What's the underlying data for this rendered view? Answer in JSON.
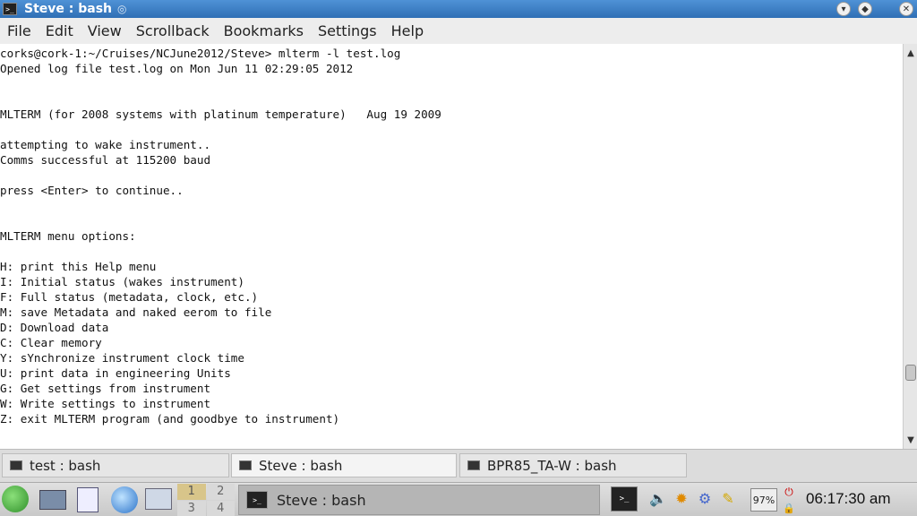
{
  "window": {
    "title": "Steve : bash",
    "icon": "terminal-icon",
    "controls": [
      "minimize-icon",
      "maximize-icon",
      "close-icon"
    ]
  },
  "menubar": {
    "items": [
      "File",
      "Edit",
      "View",
      "Scrollback",
      "Bookmarks",
      "Settings",
      "Help"
    ]
  },
  "terminal": {
    "lines": [
      "corks@cork-1:~/Cruises/NCJune2012/Steve> mlterm -l test.log",
      "Opened log file test.log on Mon Jun 11 02:29:05 2012",
      "",
      "",
      "MLTERM (for 2008 systems with platinum temperature)   Aug 19 2009",
      "",
      "attempting to wake instrument..",
      "Comms successful at 115200 baud",
      "",
      "press <Enter> to continue..",
      "",
      "",
      "MLTERM menu options:",
      "",
      "H: print this Help menu",
      "I: Initial status (wakes instrument)",
      "F: Full status (metadata, clock, etc.)",
      "M: save Metadata and naked eerom to file",
      "D: Download data",
      "C: Clear memory",
      "Y: sYnchronize instrument clock time",
      "U: print data in engineering Units",
      "G: Get settings from instrument",
      "W: Write settings to instrument",
      "Z: exit MLTERM program (and goodbye to instrument)"
    ]
  },
  "tabs": [
    {
      "label": "test : bash",
      "active": false
    },
    {
      "label": "Steve : bash",
      "active": true
    },
    {
      "label": "BPR85_TA-W : bash",
      "active": false
    }
  ],
  "taskbar": {
    "pager": [
      "1",
      "2",
      "3",
      "4"
    ],
    "task_label": "Steve : bash",
    "battery": "97%",
    "clock": "06:17:30 am"
  }
}
